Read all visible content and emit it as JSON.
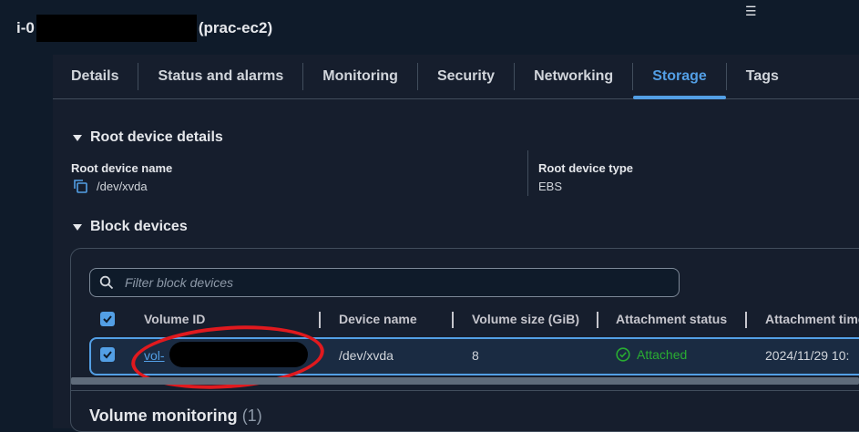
{
  "instance": {
    "id_prefix": "i-0",
    "name_suffix": "(prac-ec2)"
  },
  "tabs": [
    {
      "label": "Details"
    },
    {
      "label": "Status and alarms"
    },
    {
      "label": "Monitoring"
    },
    {
      "label": "Security"
    },
    {
      "label": "Networking"
    },
    {
      "label": "Storage",
      "active": true
    },
    {
      "label": "Tags"
    }
  ],
  "root_device": {
    "heading": "Root device details",
    "name_label": "Root device name",
    "name_value": "/dev/xvda",
    "type_label": "Root device type",
    "type_value": "EBS"
  },
  "block_devices": {
    "heading": "Block devices",
    "filter_placeholder": "Filter block devices",
    "columns": [
      "Volume ID",
      "Device name",
      "Volume size (GiB)",
      "Attachment status",
      "Attachment time"
    ],
    "rows": [
      {
        "volume_id": "vol-",
        "device_name": "/dev/xvda",
        "size": "8",
        "status": "Attached",
        "time": "2024/11/29 10:"
      }
    ]
  },
  "volume_monitoring": {
    "heading": "Volume monitoring",
    "count": "(1)"
  },
  "colors": {
    "accent": "#539fe5",
    "success": "#29ad32",
    "annotation": "#e0191e"
  }
}
